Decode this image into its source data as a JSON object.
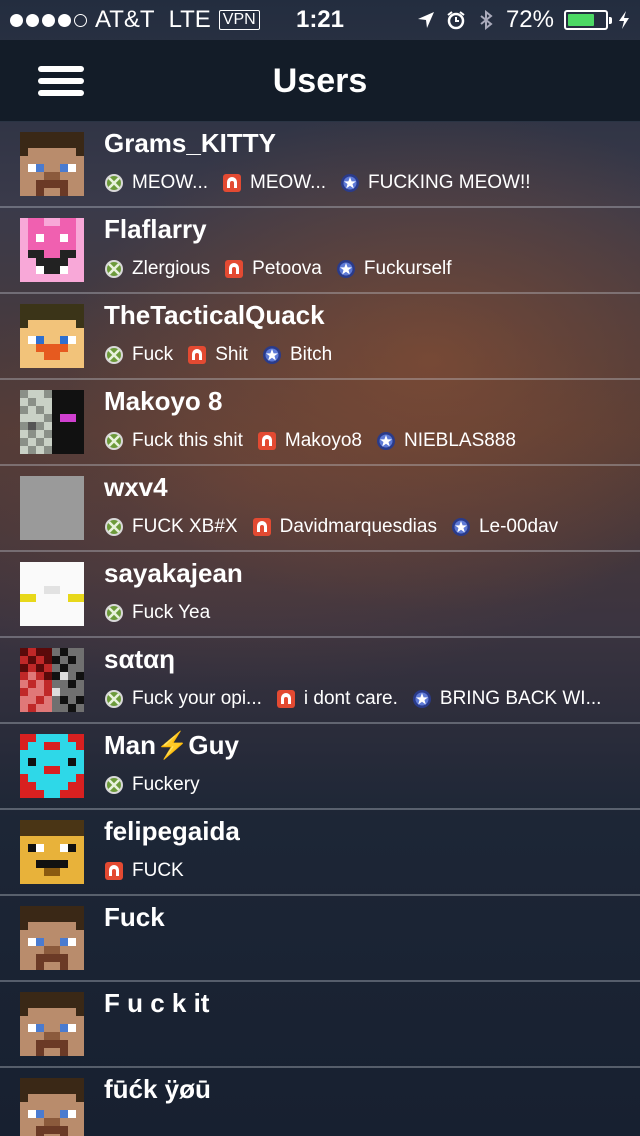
{
  "status": {
    "carrier": "AT&T",
    "network": "LTE",
    "vpn": "VPN",
    "time": "1:21",
    "battery": "72%",
    "battery_level": 0.72
  },
  "nav": {
    "title": "Users",
    "menu_icon": "hamburger-menu-icon"
  },
  "icons": {
    "xbox": "xbox-icon",
    "nintendo": "nintendo-network-icon",
    "psn": "psn-icon"
  },
  "users": [
    {
      "name": "Grams_KITTY",
      "avatar": "steve",
      "handles": [
        {
          "platform": "xbox",
          "text": "MEOW..."
        },
        {
          "platform": "nintendo",
          "text": "MEOW..."
        },
        {
          "platform": "psn",
          "text": "FUCKING MEOW!!"
        }
      ]
    },
    {
      "name": "Flaflarry",
      "avatar": "pink",
      "handles": [
        {
          "platform": "xbox",
          "text": "Zlergious"
        },
        {
          "platform": "nintendo",
          "text": "Petoova"
        },
        {
          "platform": "psn",
          "text": "Fuckurself"
        }
      ]
    },
    {
      "name": "TheTacticalQuack",
      "avatar": "quack",
      "handles": [
        {
          "platform": "xbox",
          "text": "Fuck"
        },
        {
          "platform": "nintendo",
          "text": "Shit"
        },
        {
          "platform": "psn",
          "text": "Bitch"
        }
      ]
    },
    {
      "name": "Makoyo 8",
      "avatar": "makoyo",
      "handles": [
        {
          "platform": "xbox",
          "text": "Fuck this shit"
        },
        {
          "platform": "nintendo",
          "text": "Makoyo8"
        },
        {
          "platform": "psn",
          "text": "NIEBLAS888"
        }
      ]
    },
    {
      "name": "wxv4",
      "avatar": "plain",
      "handles": [
        {
          "platform": "xbox",
          "text": "FUCK XB#X"
        },
        {
          "platform": "nintendo",
          "text": "Davidmarquesdias"
        },
        {
          "platform": "psn",
          "text": "Le-00dav"
        }
      ]
    },
    {
      "name": "sayakajean",
      "avatar": "white",
      "handles": [
        {
          "platform": "xbox",
          "text": "Fuck Yea"
        }
      ]
    },
    {
      "name": "sαtαη",
      "avatar": "satan",
      "handles": [
        {
          "platform": "xbox",
          "text": "Fuck your opi..."
        },
        {
          "platform": "nintendo",
          "text": "i dont care."
        },
        {
          "platform": "psn",
          "text": "BRING BACK WI..."
        }
      ]
    },
    {
      "name": "Man⚡Guy",
      "avatar": "cyan",
      "handles": [
        {
          "platform": "xbox",
          "text": "Fuckery"
        }
      ]
    },
    {
      "name": "felipegaida",
      "avatar": "felipe",
      "handles": [
        {
          "platform": "nintendo",
          "text": "FUCK"
        }
      ]
    },
    {
      "name": "Fuck",
      "avatar": "steve",
      "handles": []
    },
    {
      "name": " F u c k  it",
      "avatar": "steve",
      "handles": []
    },
    {
      "name": "fūćk ÿøū",
      "avatar": "steve",
      "handles": []
    }
  ]
}
